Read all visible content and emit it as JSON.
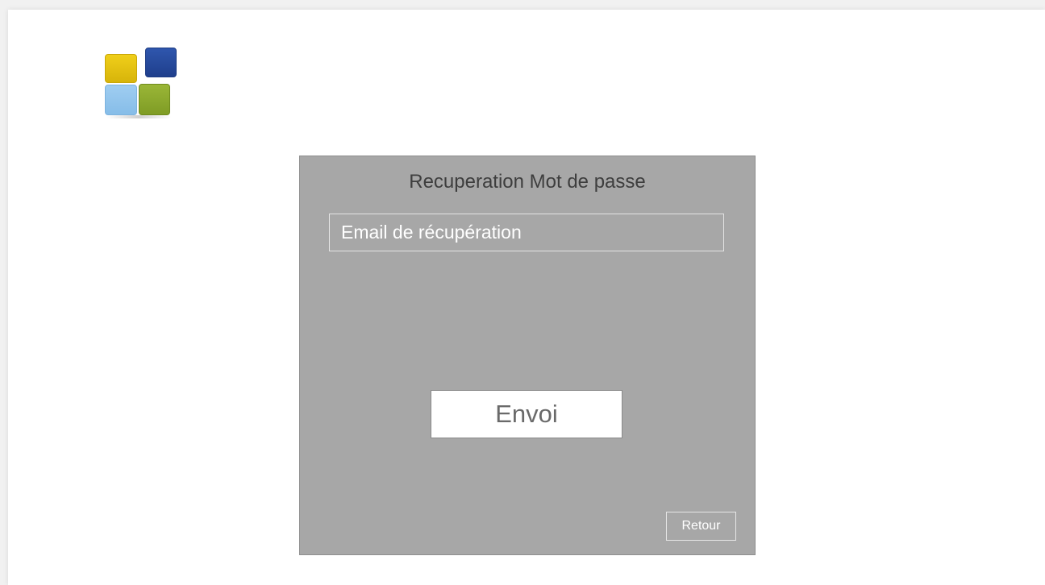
{
  "logo": {
    "icon": "four-tiles-logo-icon",
    "colors": [
      "#e2c20f",
      "#26489c",
      "#93c6ee",
      "#8bab2d"
    ]
  },
  "panel": {
    "title": "Recuperation Mot de passe",
    "background": "#a7a7a7",
    "email": {
      "placeholder": "Email de récupération",
      "value": ""
    },
    "send_label": "Envoi",
    "back_label": "Retour"
  }
}
